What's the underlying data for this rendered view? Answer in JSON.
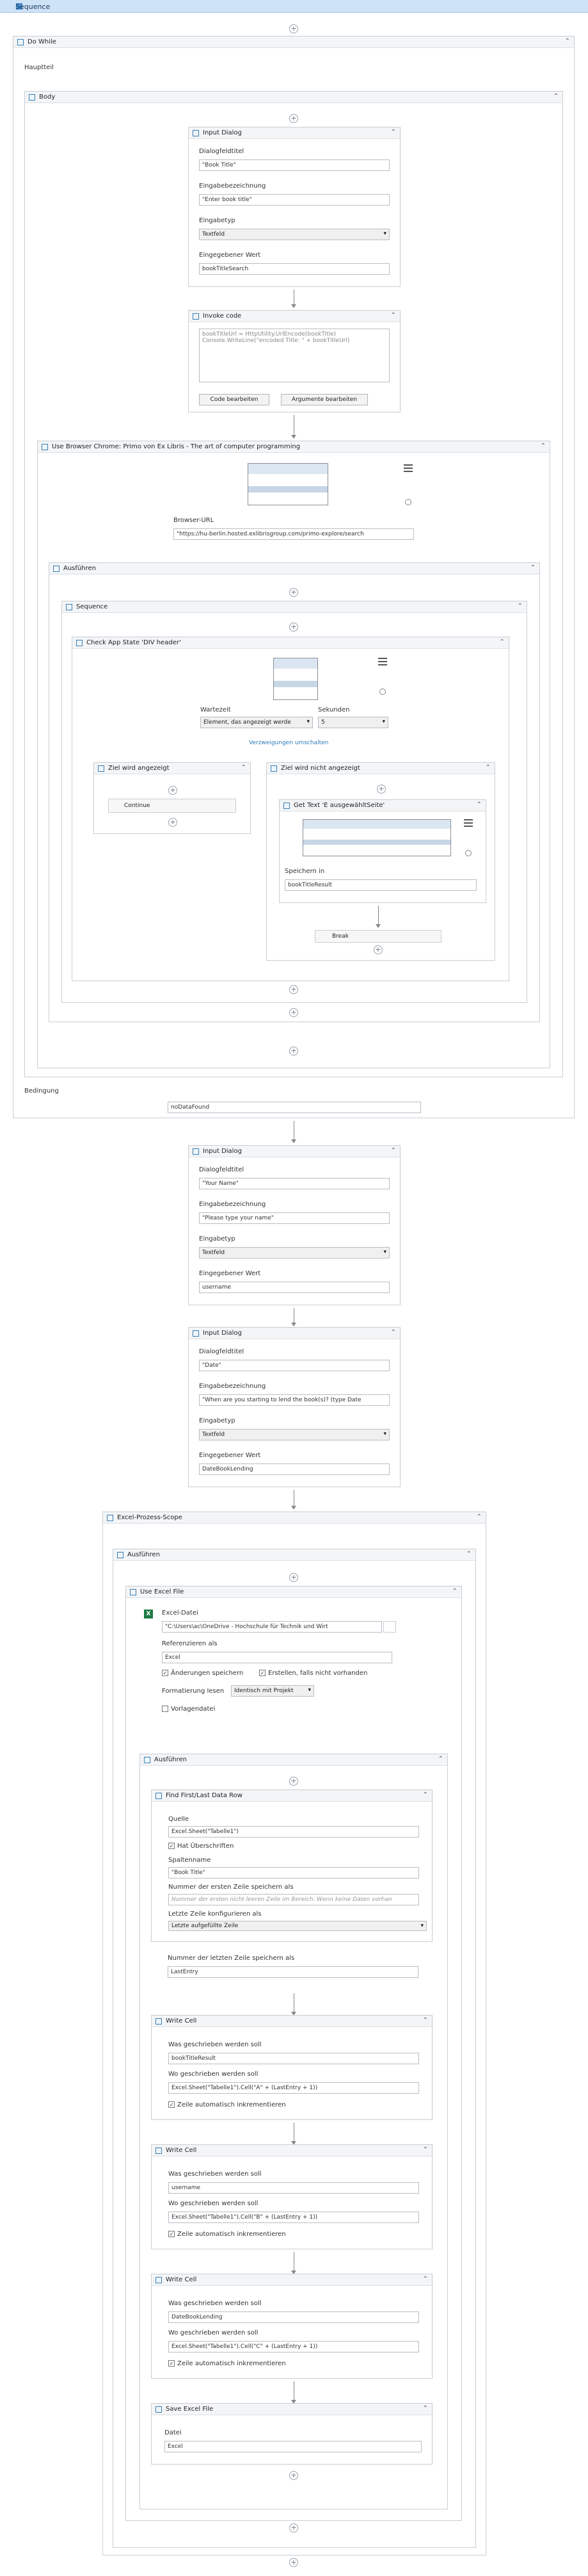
{
  "title": "Sequence",
  "do_while": {
    "title": "Do While",
    "hauptteil": "Hauptteil",
    "body": "Body",
    "bedingung": "Bedingung",
    "condition": "noDataFound"
  },
  "input1": {
    "title": "Input Dialog",
    "l1": "Dialogfeldtitel",
    "v1": "\"Book Title\"",
    "l2": "Eingabebezeichnung",
    "v2": "\"Enter book title\"",
    "l3": "Eingabetyp",
    "v3": "Textfeld",
    "l4": "Eingegebener Wert",
    "v4": "bookTitleSearch"
  },
  "invoke": {
    "title": "Invoke code",
    "code1": "bookTitleUrl = HttpUtility.UrlEncode(bookTitle)",
    "code2": "Console.WriteLine(\"encoded Title: \" + bookTitleUrl)",
    "btn1": "Code bearbeiten",
    "btn2": "Argumente bearbeiten"
  },
  "browser": {
    "title": "Use Browser Chrome: Primo von Ex Libris - The art of computer programming",
    "url_label": "Browser-URL",
    "url": "\"https://hu-berlin.hosted.exlibrisgroup.com/primo-explore/search",
    "ausfuehren": "Ausführen"
  },
  "sequence2": "Sequence",
  "check": {
    "title": "Check App State 'DIV header'",
    "wartezeit": "Wartezeit",
    "sekunden": "Sekunden",
    "wait_val": "Element, das angezeigt werde",
    "sec_val": "5",
    "link": "Verzweigungen umschalten",
    "ziel_yes": "Ziel wird angezeigt",
    "ziel_no": "Ziel wird nicht angezeigt",
    "continue": "Continue"
  },
  "gettext": {
    "title": "Get Text 'E ausgewähltSeite'",
    "save_label": "Speichern in",
    "save_val": "bookTitleResult",
    "break": "Break"
  },
  "input2": {
    "title": "Input Dialog",
    "l1": "Dialogfeldtitel",
    "v1": "\"Your Name\"",
    "l2": "Eingabebezeichnung",
    "v2": "\"Please type your name\"",
    "l3": "Eingabetyp",
    "v3": "Textfeld",
    "l4": "Eingegebener Wert",
    "v4": "username"
  },
  "input3": {
    "title": "Input Dialog",
    "l1": "Dialogfeldtitel",
    "v1": "\"Date\"",
    "l2": "Eingabebezeichnung",
    "v2": "\"When are you starting to lend the book(s)? (type Date",
    "l3": "Eingabetyp",
    "v3": "Textfeld",
    "l4": "Eingegebener Wert",
    "v4": "DateBookLending"
  },
  "excel": {
    "scope": "Excel-Prozess-Scope",
    "ausfuehren": "Ausführen",
    "use": "Use Excel File",
    "datei": "Excel-Datei",
    "path": "\"C:\\Users\\ac\\OneDrive - Hochschule für Technik und Wirt",
    "ref": "Referenzieren als",
    "ref_val": "Excel",
    "save_changes": "Änderungen speichern",
    "create": "Erstellen, falls nicht vorhanden",
    "format_label": "Formatierung lesen",
    "format_val": "Identisch mit Projekt",
    "template": "Vorlagendatei",
    "ausfuehren2": "Ausführen"
  },
  "find": {
    "title": "Find First/Last Data Row",
    "quelle": "Quelle",
    "quelle_val": "Excel.Sheet(\"Tabelle1\")",
    "has_header": "Hat Überschriften",
    "col_name": "Spaltenname",
    "col_val": "\"Book Title\"",
    "first_label": "Nummer der ersten Zeile speichern als",
    "first_ph": "Nummer der ersten nicht leeren Zeile im Bereich. Wenn keine Daten vorhan",
    "conf_label": "Letzte Zeile konfigurieren als",
    "conf_val": "Letzte aufgefüllte Zeile",
    "last_label": "Nummer der letzten Zeile speichern als",
    "last_val": "LastEntry"
  },
  "write1": {
    "title": "Write Cell",
    "what": "Was geschrieben werden soll",
    "what_val": "bookTitleResult",
    "where": "Wo geschrieben werden soll",
    "where_val": "Excel.Sheet(\"Tabelle1\").Cell(\"A\" + (LastEntry + 1))",
    "auto": "Zeile automatisch inkrementieren"
  },
  "write2": {
    "title": "Write Cell",
    "what": "Was geschrieben werden soll",
    "what_val": "username",
    "where": "Wo geschrieben werden soll",
    "where_val": "Excel.Sheet(\"Tabelle1\").Cell(\"B\" + (LastEntry + 1))",
    "auto": "Zeile automatisch inkrementieren"
  },
  "write3": {
    "title": "Write Cell",
    "what": "Was geschrieben werden soll",
    "what_val": "DateBookLending",
    "where": "Wo geschrieben werden soll",
    "where_val": "Excel.Sheet(\"Tabelle1\").Cell(\"C\" + (LastEntry + 1))",
    "auto": "Zeile automatisch inkrementieren"
  },
  "save": {
    "title": "Save Excel File",
    "datei": "Datei",
    "val": "Excel"
  },
  "icons": {
    "plus": "+",
    "collapse": "⌃",
    "check": "✓",
    "excel": "X",
    "play": "▶"
  }
}
